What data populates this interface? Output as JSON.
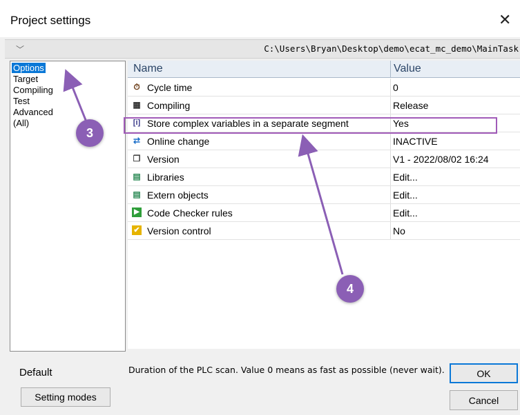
{
  "window": {
    "title": "Project settings",
    "close_icon": "close-icon"
  },
  "path_bar": {
    "path": "C:\\Users\\Bryan\\Desktop\\demo\\ecat_mc_demo\\MainTask"
  },
  "categories": [
    {
      "label": "Options",
      "selected": true
    },
    {
      "label": "Target",
      "selected": false
    },
    {
      "label": "Compiling",
      "selected": false
    },
    {
      "label": "Test",
      "selected": false
    },
    {
      "label": "Advanced",
      "selected": false
    },
    {
      "label": "(All)",
      "selected": false
    }
  ],
  "grid": {
    "columns": [
      "Name",
      "Value"
    ],
    "rows": [
      {
        "icon": "stopwatch-icon",
        "name": "Cycle time",
        "value": "0"
      },
      {
        "icon": "compile-icon",
        "name": "Compiling",
        "value": "Release"
      },
      {
        "icon": "variables-icon",
        "name": "Store complex variables in a separate segment",
        "value": "Yes"
      },
      {
        "icon": "refresh-icon",
        "name": "Online change",
        "value": "INACTIVE"
      },
      {
        "icon": "version-icon",
        "name": "Version",
        "value": "V1 - 2022/08/02 16:24"
      },
      {
        "icon": "library-icon",
        "name": "Libraries",
        "value": "Edit..."
      },
      {
        "icon": "library-icon",
        "name": "Extern objects",
        "value": "Edit..."
      },
      {
        "icon": "checker-icon",
        "name": "Code Checker rules",
        "value": "Edit..."
      },
      {
        "icon": "checkmark-icon",
        "name": "Version control",
        "value": "No"
      }
    ]
  },
  "footer": {
    "default_label": "Default",
    "setting_modes_label": "Setting modes",
    "description": "Duration of the PLC scan. Value 0 means as fast as possible (never wait).",
    "ok_label": "OK",
    "cancel_label": "Cancel"
  },
  "annotations": {
    "badge_3": "3",
    "badge_4": "4",
    "color": "#8b5fb5"
  }
}
